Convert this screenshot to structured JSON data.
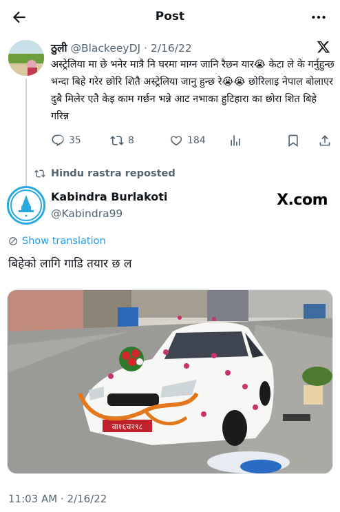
{
  "header": {
    "title": "Post",
    "back_icon": "arrow-left-icon",
    "more_icon": "more-horizontal-icon"
  },
  "quoted_tweet": {
    "name": "ठुली",
    "handle": "@BlackeeyDJ",
    "separator": "·",
    "date": "2/16/22",
    "platform_icon": "x-logo-icon",
    "text": "अस्ट्रेलिया मा छे भनेर मात्रै नि  घरमा माग्न जानि रैछन यार😭 केटा ले के गर्नुहुन्छ भन्दा बिहे गरेर छोरि शितै अस्ट्रेलिया जानु हुन्छ रे😭😭  छोरिलाइ नेपाल बोलाएर दुबै मिलेर एतै केइ काम गर्छन भन्ने आट नभाका हुटिहारा का छोरा शित बिहे गरिन्न",
    "replies": "35",
    "retweets": "8",
    "likes": "184",
    "views_icon": "analytics-icon",
    "bookmark_icon": "bookmark-icon",
    "share_icon": "share-icon"
  },
  "repost": {
    "label": "Hindu rastra reposted"
  },
  "post": {
    "name": "Kabindra Burlakoti",
    "handle": "@Kabindra99",
    "watermark": "X.com",
    "show_translation": "Show translation",
    "text": "बिहेको लागि गाडि तयार छ ल",
    "plate_text": "बा१६च२९८",
    "timestamp": "11:03 AM · 2/16/22"
  },
  "colors": {
    "accent": "#1d9bf0",
    "muted": "#536471",
    "text": "#0f1419",
    "avatar_ring": "#29a8e0"
  }
}
